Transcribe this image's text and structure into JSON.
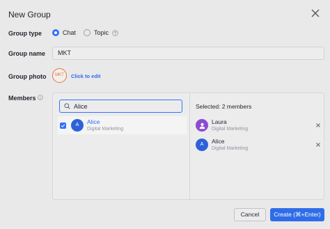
{
  "dialog": {
    "title": "New Group"
  },
  "group_type": {
    "label": "Group type",
    "options": [
      {
        "label": "Chat",
        "selected": true
      },
      {
        "label": "Topic",
        "selected": false
      }
    ]
  },
  "group_name": {
    "label": "Group name",
    "value": "MKT"
  },
  "group_photo": {
    "label": "Group photo",
    "avatar_text": "MKT",
    "edit_label": "Click to edit"
  },
  "members": {
    "label": "Members",
    "search_value": "Alice",
    "results": [
      {
        "initial": "A",
        "name": "Alice",
        "department": "Digital Marketing",
        "checked": true
      }
    ],
    "selected_header": "Selected: 2 members",
    "selected": [
      {
        "avatar": "user-icon",
        "name": "Laura",
        "department": "Digital Marketing"
      },
      {
        "initial": "A",
        "name": "Alice",
        "department": "Digital Marketing"
      }
    ]
  },
  "footer": {
    "cancel_label": "Cancel",
    "create_label": "Create (⌘+Enter)"
  },
  "colors": {
    "accent": "#2f6de8",
    "photo_accent": "#e4763a",
    "laura_avatar": "#8b4bd2"
  }
}
